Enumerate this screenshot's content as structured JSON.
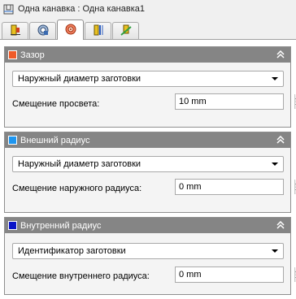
{
  "window": {
    "title": "Одна канавка : Одна канавка1",
    "title_icon": "groove-feature-icon"
  },
  "tabs": [
    {
      "icon": "tool-placement-icon",
      "active": false
    },
    {
      "icon": "toolpath-geometry-icon",
      "active": false
    },
    {
      "icon": "clearance-settings-icon",
      "active": true
    },
    {
      "icon": "feed-settings-icon",
      "active": false
    },
    {
      "icon": "approach-settings-icon",
      "active": false
    }
  ],
  "sections": [
    {
      "title": "Зазор",
      "color": "#f05a28",
      "dropdown": "Наружный диаметр заготовки",
      "field_label": "Смещение просвета:",
      "field_value": "10 mm"
    },
    {
      "title": "Внешний радиус",
      "color": "#1e96f0",
      "dropdown": "Наружный диаметр заготовки",
      "field_label": "Смещение наружного радиуса:",
      "field_value": "0 mm"
    },
    {
      "title": "Внутренний радиус",
      "color": "#0a14c8",
      "dropdown": "Идентификатор заготовки",
      "field_label": "Смещение внутреннего радиуса:",
      "field_value": "0 mm"
    }
  ],
  "collapse_icon": "chevron-double-up-icon"
}
